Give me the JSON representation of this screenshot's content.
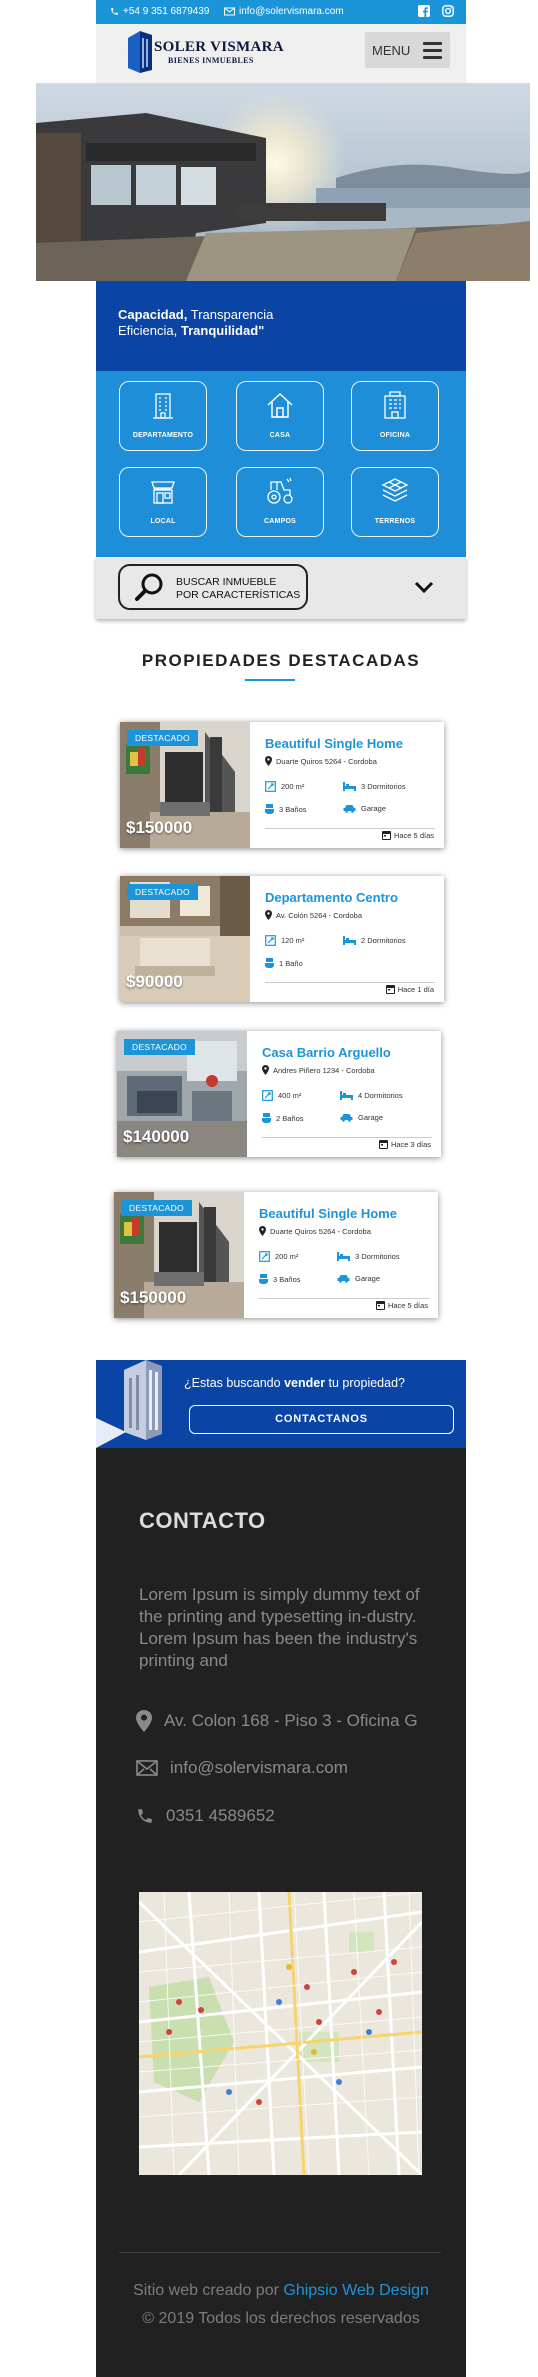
{
  "topbar": {
    "phone": "+54 9 351 6879439",
    "email": "info@solervismara.com",
    "social_icons": [
      "facebook-icon",
      "instagram-icon"
    ]
  },
  "header": {
    "brand": "SOLER VISMARA",
    "brand_sub": "BIENES INMUEBLES",
    "menu_label": "MENU"
  },
  "slogan": {
    "line1_bold": "Capacidad,",
    "line1_rest": " Transparencia",
    "line2_start": "Eficiencia, ",
    "line2_bold": "Tranquilidad\""
  },
  "categories": [
    {
      "label": "DEPARTAMENTO",
      "icon": "building-icon"
    },
    {
      "label": "CASA",
      "icon": "house-icon"
    },
    {
      "label": "OFICINA",
      "icon": "office-icon"
    },
    {
      "label": "LOCAL",
      "icon": "store-icon"
    },
    {
      "label": "CAMPOS",
      "icon": "tractor-icon"
    },
    {
      "label": "TERRENOS",
      "icon": "land-icon"
    }
  ],
  "search": {
    "line1": "BUSCAR INMUEBLE",
    "line2": "POR CARACTERÍSTICAS"
  },
  "featured": {
    "title": "PROPIEDADES DESTACADAS",
    "badge": "DESTACADO",
    "items": [
      {
        "price": "$150000",
        "title": "Beautiful Single Home",
        "address": "Duarte Quiros 5264 - Cordoba",
        "area": "200 m²",
        "bedrooms": "3 Dormitorios",
        "baths": "3 Baños",
        "garage": "Garage",
        "ago": "Hace 5 días"
      },
      {
        "price": "$90000",
        "title": "Departamento Centro",
        "address": "Av. Colón 5264 - Cordoba",
        "area": "120 m²",
        "bedrooms": "2 Dormitorios",
        "baths": "1 Baño",
        "garage": "",
        "ago": "Hace 1 día"
      },
      {
        "price": "$140000",
        "title": "Casa Barrio Arguello",
        "address": "Andres Piñero 1234 - Cordoba",
        "area": "400 m²",
        "bedrooms": "4 Dormitorios",
        "baths": "2 Baños",
        "garage": "Garage",
        "ago": "Hace 3 días"
      },
      {
        "price": "$150000",
        "title": "Beautiful Single Home",
        "address": "Duarte Quiros 5264 - Cordoba",
        "area": "200 m²",
        "bedrooms": "3 Dormitorios",
        "baths": "3 Baños",
        "garage": "Garage",
        "ago": "Hace 5 días"
      }
    ]
  },
  "cta": {
    "q_start": "¿Estas buscando ",
    "q_bold": "vender",
    "q_end": " tu propiedad?",
    "button": "CONTACTANOS"
  },
  "contact": {
    "heading": "CONTACTO",
    "text": "Lorem Ipsum is simply dummy text of the printing and typesetting in-dustry. Lorem Ipsum has been the industry's printing and",
    "address": "Av. Colon 168 - Piso 3 - Oficina G",
    "email": "info@solervismara.com",
    "phone": "0351 4589652"
  },
  "footer": {
    "credit": "Sitio web creado por ",
    "credit_link": "Ghipsio Web Design",
    "copyright": "© 2019 Todos los derechos reservados"
  },
  "colors": {
    "primary": "#1c95d8",
    "navy": "#0a45a6",
    "dark": "#212121"
  }
}
